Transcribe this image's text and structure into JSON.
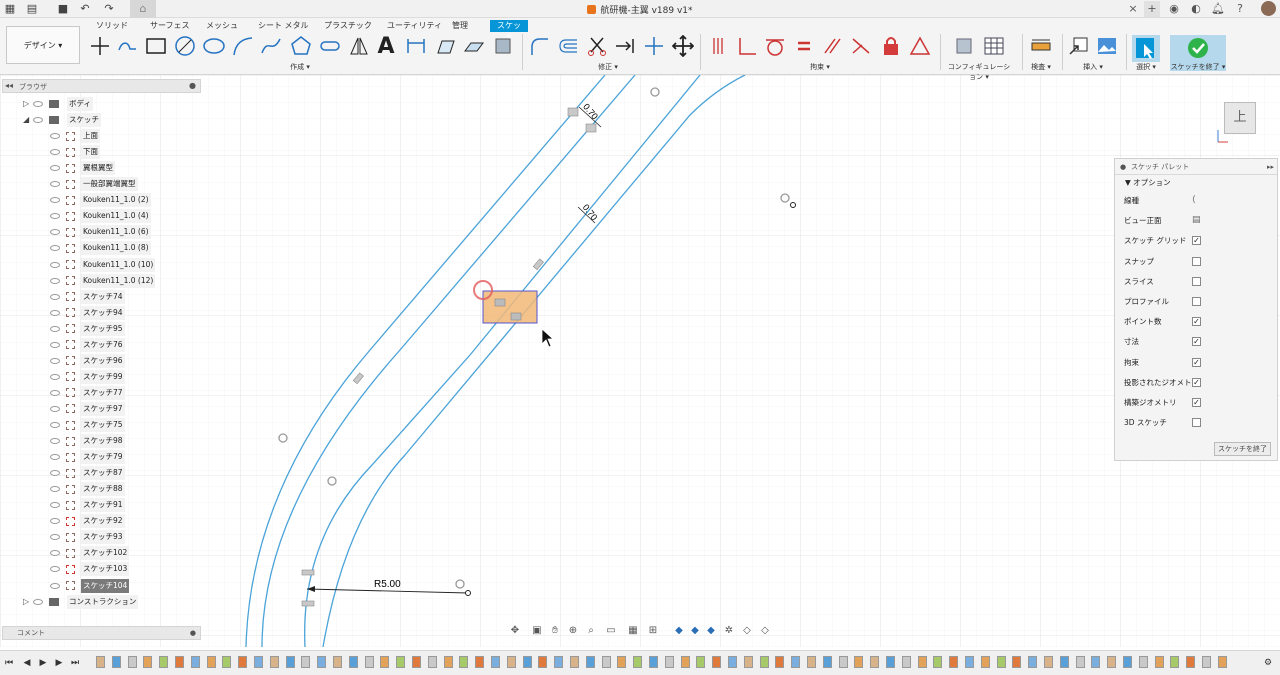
{
  "titlebar": {
    "doc_title": "航研機-主翼 v189 v1*"
  },
  "ribbon": {
    "tabs": [
      {
        "label": "ソリッド",
        "active": false
      },
      {
        "label": "サーフェス",
        "active": false
      },
      {
        "label": "メッシュ",
        "active": false
      },
      {
        "label": "シート メタル",
        "active": false
      },
      {
        "label": "プラスチック",
        "active": false
      },
      {
        "label": "ユーティリティ",
        "active": false
      },
      {
        "label": "管理",
        "active": false
      },
      {
        "label": "スケッチ",
        "active": true
      }
    ],
    "workspace_button": "デザイン ▾",
    "groups": {
      "create": "作成 ▾",
      "modify": "修正 ▾",
      "constraints": "拘束 ▾",
      "configure": "コンフィギュレーション ▾",
      "inspect": "検査 ▾",
      "insert": "挿入 ▾",
      "select": "選択 ▾",
      "finish": "スケッチを終了 ▾"
    },
    "text_tool_glyph": "A"
  },
  "browser": {
    "title": "ブラウザ",
    "items": [
      {
        "label": "ボディ",
        "type": "folder",
        "collapsed": true
      },
      {
        "label": "スケッチ",
        "type": "folder",
        "collapsed": false
      },
      {
        "label": "上面",
        "type": "sketch"
      },
      {
        "label": "下面",
        "type": "sketch"
      },
      {
        "label": "翼根翼型",
        "type": "sketch"
      },
      {
        "label": "一般部翼端翼型",
        "type": "sketch"
      },
      {
        "label": "Kouken11_1.0 (2)",
        "type": "sketch"
      },
      {
        "label": "Kouken11_1.0 (4)",
        "type": "sketch"
      },
      {
        "label": "Kouken11_1.0 (6)",
        "type": "sketch"
      },
      {
        "label": "Kouken11_1.0 (8)",
        "type": "sketch"
      },
      {
        "label": "Kouken11_1.0 (10)",
        "type": "sketch"
      },
      {
        "label": "Kouken11_1.0 (12)",
        "type": "sketch"
      },
      {
        "label": "スケッチ74",
        "type": "sketch"
      },
      {
        "label": "スケッチ94",
        "type": "sketch"
      },
      {
        "label": "スケッチ95",
        "type": "sketch"
      },
      {
        "label": "スケッチ76",
        "type": "sketch"
      },
      {
        "label": "スケッチ96",
        "type": "sketch"
      },
      {
        "label": "スケッチ99",
        "type": "sketch"
      },
      {
        "label": "スケッチ77",
        "type": "sketch"
      },
      {
        "label": "スケッチ97",
        "type": "sketch"
      },
      {
        "label": "スケッチ75",
        "type": "sketch"
      },
      {
        "label": "スケッチ98",
        "type": "sketch"
      },
      {
        "label": "スケッチ79",
        "type": "sketch"
      },
      {
        "label": "スケッチ87",
        "type": "sketch"
      },
      {
        "label": "スケッチ88",
        "type": "sketch"
      },
      {
        "label": "スケッチ91",
        "type": "sketch"
      },
      {
        "label": "スケッチ92",
        "type": "sketch-red"
      },
      {
        "label": "スケッチ93",
        "type": "sketch"
      },
      {
        "label": "スケッチ102",
        "type": "sketch"
      },
      {
        "label": "スケッチ103",
        "type": "sketch-red"
      },
      {
        "label": "スケッチ104",
        "type": "sketch",
        "selected": true
      },
      {
        "label": "コンストラクション",
        "type": "folder",
        "collapsed": true
      }
    ]
  },
  "comment_bar": "コメント",
  "canvas": {
    "dimensions": [
      "0.70",
      "0.70",
      "R5.00"
    ]
  },
  "view_cube": "上",
  "palette": {
    "title": "スケッチ パレット",
    "section": "▼ オプション",
    "rows": [
      {
        "label": "線種",
        "kind": "icon",
        "checked": false
      },
      {
        "label": "ビュー正面",
        "kind": "icon",
        "checked": false
      },
      {
        "label": "スケッチ グリッド",
        "kind": "checkbox",
        "checked": true
      },
      {
        "label": "スナップ",
        "kind": "checkbox",
        "checked": false
      },
      {
        "label": "スライス",
        "kind": "checkbox",
        "checked": false
      },
      {
        "label": "プロファイル",
        "kind": "checkbox",
        "checked": false
      },
      {
        "label": "ポイント数",
        "kind": "checkbox",
        "checked": true
      },
      {
        "label": "寸法",
        "kind": "checkbox",
        "checked": true
      },
      {
        "label": "拘束",
        "kind": "checkbox",
        "checked": true
      },
      {
        "label": "投影されたジオメトリ",
        "kind": "checkbox",
        "checked": true
      },
      {
        "label": "構築ジオメトリ",
        "kind": "checkbox",
        "checked": true
      },
      {
        "label": "3D スケッチ",
        "kind": "checkbox",
        "checked": false
      }
    ],
    "finish_button": "スケッチを終了"
  },
  "colors": {
    "accent": "#0696d7",
    "sketch_line": "#4aa3d9",
    "selection_fill": "#f2b978",
    "selection_border": "#5555cc",
    "grid": "#e3e3e3",
    "finish_green": "#2db34a"
  }
}
